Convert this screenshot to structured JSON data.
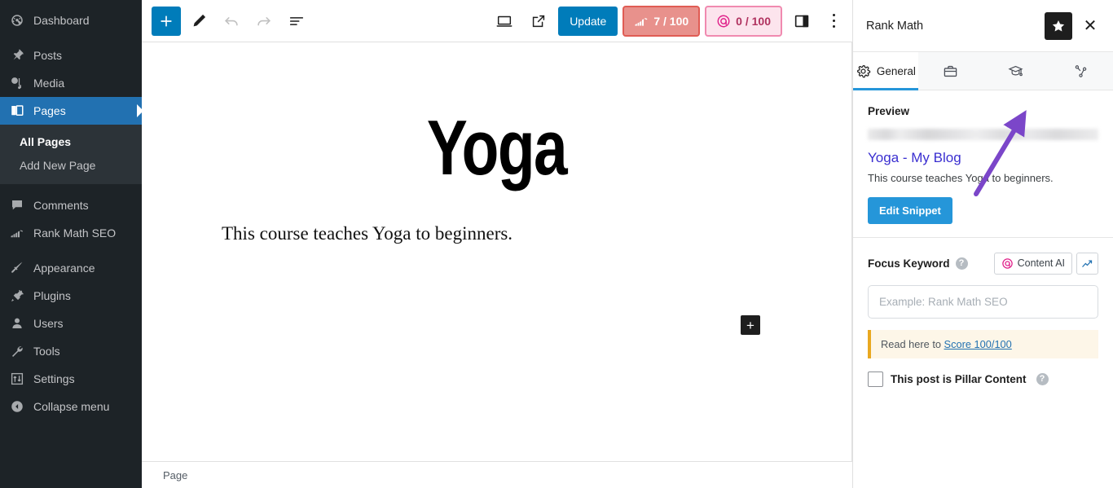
{
  "wp_sidebar": {
    "items": [
      {
        "label": "Dashboard",
        "icon": "dashboard-icon",
        "current": false
      },
      {
        "label": "Posts",
        "icon": "pin-icon",
        "current": false
      },
      {
        "label": "Media",
        "icon": "media-icon",
        "current": false
      },
      {
        "label": "Pages",
        "icon": "pages-icon",
        "current": true
      },
      {
        "label": "Comments",
        "icon": "comment-icon",
        "current": false
      },
      {
        "label": "Rank Math SEO",
        "icon": "rank-math-icon",
        "current": false
      },
      {
        "label": "Appearance",
        "icon": "brush-icon",
        "current": false
      },
      {
        "label": "Plugins",
        "icon": "plug-icon",
        "current": false
      },
      {
        "label": "Users",
        "icon": "user-icon",
        "current": false
      },
      {
        "label": "Tools",
        "icon": "wrench-icon",
        "current": false
      },
      {
        "label": "Settings",
        "icon": "sliders-icon",
        "current": false
      },
      {
        "label": "Collapse menu",
        "icon": "collapse-icon",
        "current": false
      }
    ],
    "submenu": [
      {
        "label": "All Pages",
        "current": true
      },
      {
        "label": "Add New Page",
        "current": false
      }
    ]
  },
  "editor_header": {
    "add_block_label": "+",
    "tools": [
      "add-block-icon",
      "edit-pencil-icon",
      "undo-icon",
      "redo-icon",
      "document-overview-icon"
    ],
    "preview_icon": "desktop-preview-icon",
    "view_icon": "external-link-icon",
    "update_label": "Update",
    "seo_score": "7 / 100",
    "content_ai_score": "0 / 100",
    "settings_icon": "sidebar-toggle-icon",
    "options_icon": "kebab-menu-icon"
  },
  "canvas": {
    "title": "Yoga",
    "paragraph": "This course teaches Yoga to beginners.",
    "add_block_label": "+"
  },
  "footer": {
    "breadcrumb": "Page"
  },
  "rank_math": {
    "panel_title": "Rank Math",
    "star_icon": "star-icon",
    "close_icon": "close-icon",
    "tabs": [
      {
        "label": "General",
        "icon": "gear-icon",
        "active": true
      },
      {
        "label": "",
        "icon": "briefcase-icon",
        "active": false
      },
      {
        "label": "",
        "icon": "graduation-cap-icon",
        "active": false
      },
      {
        "label": "",
        "icon": "share-nodes-icon",
        "active": false
      }
    ],
    "preview": {
      "heading": "Preview",
      "url_blurred": true,
      "title": "Yoga - My Blog",
      "description": "This course teaches Yoga to beginners.",
      "edit_button": "Edit Snippet"
    },
    "focus_keyword": {
      "label": "Focus Keyword",
      "help_icon": "?",
      "content_ai_label": "Content AI",
      "trend_icon": "trending-up-icon",
      "placeholder": "Example: Rank Math SEO",
      "value": ""
    },
    "notice": {
      "prefix": "Read here to ",
      "link": "Score 100/100"
    },
    "pillar": {
      "label": "This post is Pillar Content",
      "checked": false,
      "help_icon": "?"
    }
  },
  "annotation": {
    "arrow_color": "#7b46c9",
    "points_to": "graduation-cap-icon"
  },
  "colors": {
    "wp_admin_bg": "#1d2327",
    "wp_submenu_bg": "#2c3338",
    "wp_active_blue": "#2271b1",
    "primary_blue": "#007cba",
    "rm_blue": "#2596d9",
    "seo_badge_bg": "#e8918c",
    "seo_badge_border": "#e05c54",
    "ai_badge_bg": "#fce4ed",
    "ai_badge_border": "#f08ab0",
    "notice_bg": "#fdf6e8",
    "notice_border": "#e9a820",
    "snippet_title": "#3a2fd0"
  }
}
